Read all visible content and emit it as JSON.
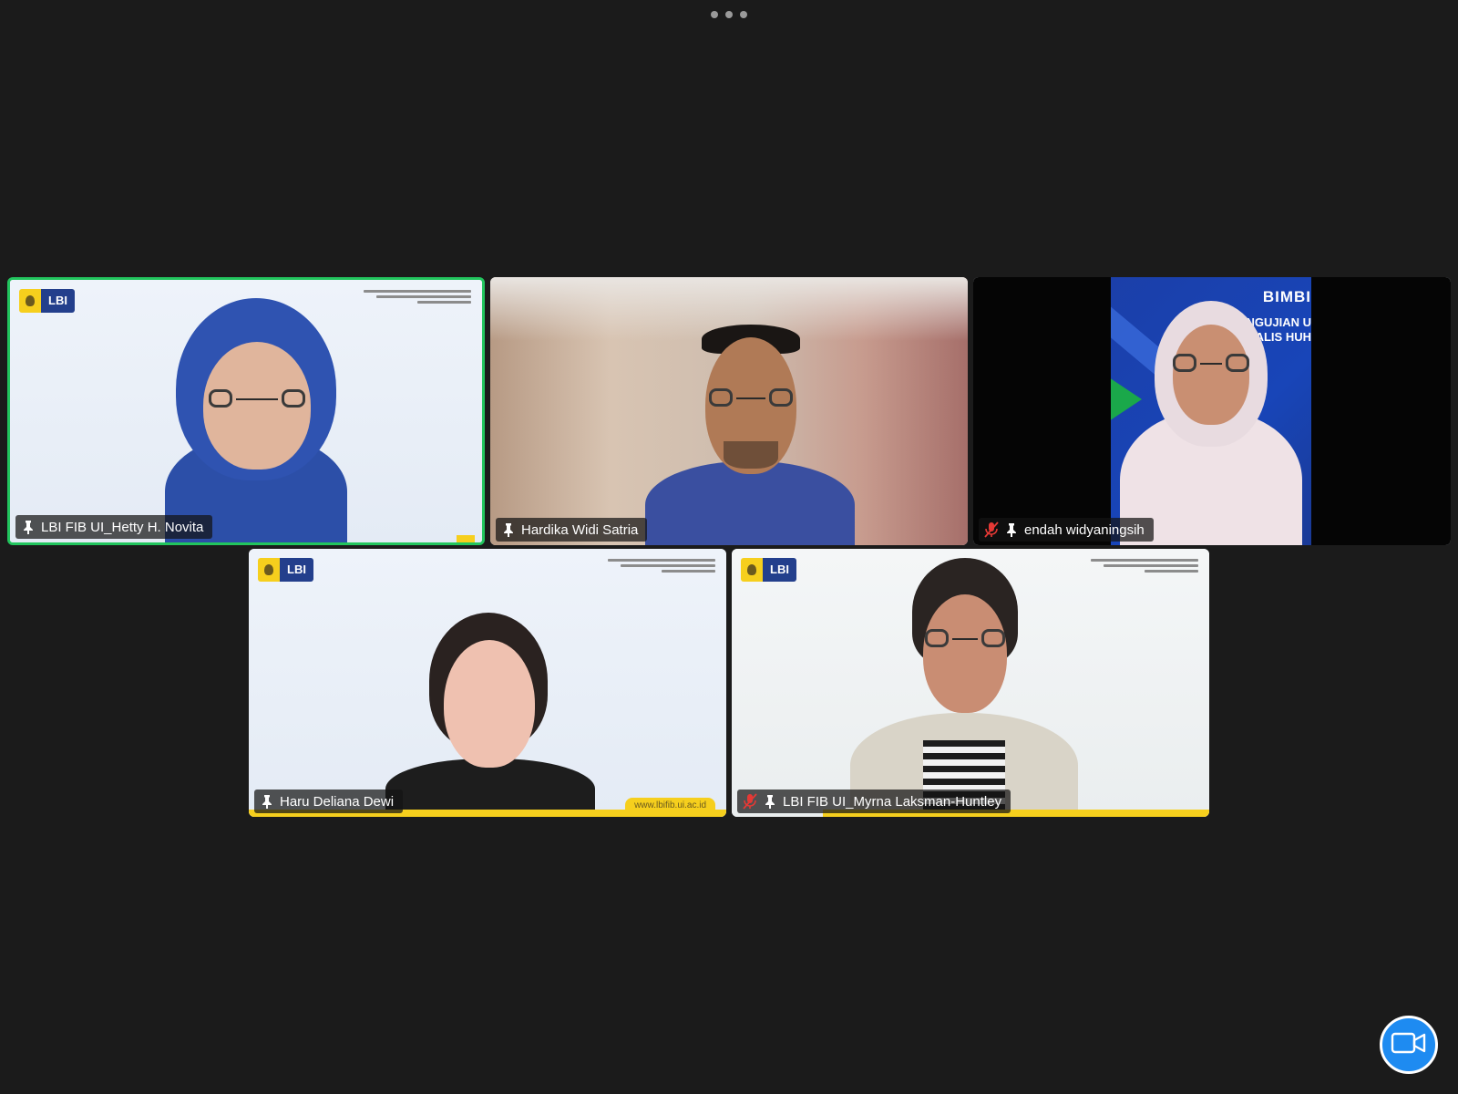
{
  "top_bar": {
    "more_icon": "more-horizontal-icon"
  },
  "participants": [
    {
      "name": "LBI FIB UI_Hetty H. Novita",
      "muted": false,
      "pinned_icon": "pin-icon",
      "active_speaker": true,
      "badge": "LBI"
    },
    {
      "name": "Hardika Widi Satria",
      "muted": false,
      "pinned_icon": "pin-icon",
      "active_speaker": false
    },
    {
      "name": "endah widyaningsih",
      "muted": true,
      "pinned_icon": "pin-icon",
      "active_speaker": false,
      "slide_title": "BIMBI",
      "slide_line1": "PENGUJIAN U",
      "slide_line2": "ANALIS HUH"
    },
    {
      "name": "Haru Deliana Dewi",
      "muted": false,
      "pinned_icon": "pin-icon",
      "active_speaker": false,
      "badge": "LBI",
      "url": "www.lbifib.ui.ac.id"
    },
    {
      "name": "LBI FIB UI_Myrna Laksman-Huntley",
      "muted": true,
      "pinned_icon": "pin-icon",
      "active_speaker": false,
      "badge": "LBI"
    }
  ],
  "controls": {
    "camera_icon": "video-camera-icon"
  },
  "colors": {
    "background": "#1b1b1b",
    "active_speaker_border": "#22c55e",
    "camera_button": "#1e8bf1",
    "lbi_blue": "#233f8c",
    "lbi_yellow": "#f6cf1d",
    "muted_red": "#e53935"
  }
}
